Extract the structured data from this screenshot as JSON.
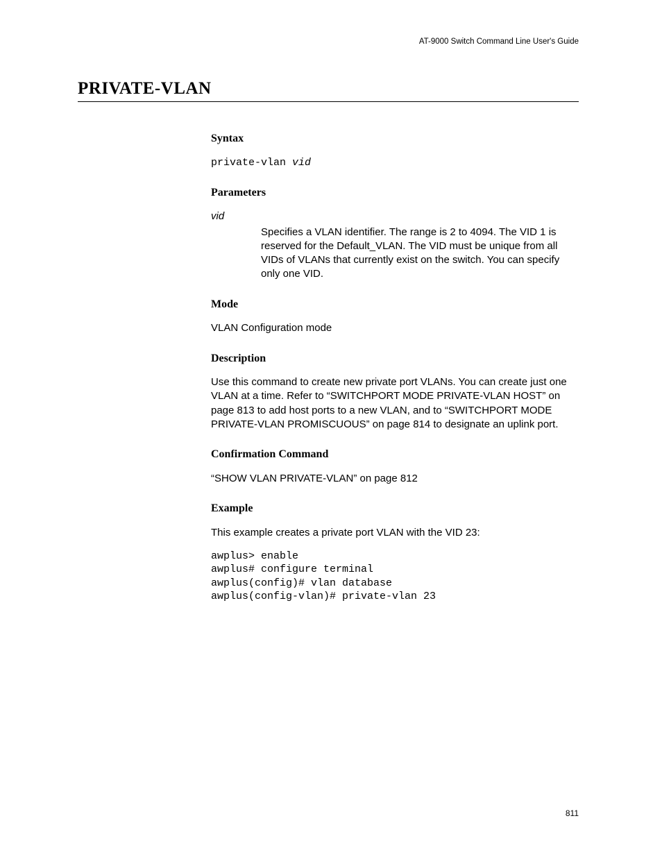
{
  "header": {
    "running": "AT-9000 Switch Command Line User's Guide"
  },
  "title": "PRIVATE-VLAN",
  "sections": {
    "syntax": {
      "heading": "Syntax",
      "command": "private-vlan ",
      "arg": "vid"
    },
    "parameters": {
      "heading": "Parameters",
      "param_name": "vid",
      "param_desc": "Specifies a VLAN identifier. The range is 2 to 4094. The VID 1 is reserved for the Default_VLAN. The VID must be unique from all VIDs of VLANs that currently exist on the switch. You can specify only one VID."
    },
    "mode": {
      "heading": "Mode",
      "text": "VLAN Configuration mode"
    },
    "description": {
      "heading": "Description",
      "text": "Use this command to create new private port VLANs. You can create just one VLAN at a time. Refer to “SWITCHPORT MODE PRIVATE-VLAN HOST” on page 813 to add host ports to a new VLAN, and to “SWITCHPORT MODE PRIVATE-VLAN PROMISCUOUS” on page 814 to designate an uplink port."
    },
    "confirmation": {
      "heading": "Confirmation Command",
      "text": "“SHOW VLAN PRIVATE-VLAN” on page 812"
    },
    "example": {
      "heading": "Example",
      "intro": "This example creates a private port VLAN with the VID 23:",
      "code": "awplus> enable\nawplus# configure terminal\nawplus(config)# vlan database\nawplus(config-vlan)# private-vlan 23"
    }
  },
  "page_number": "811"
}
